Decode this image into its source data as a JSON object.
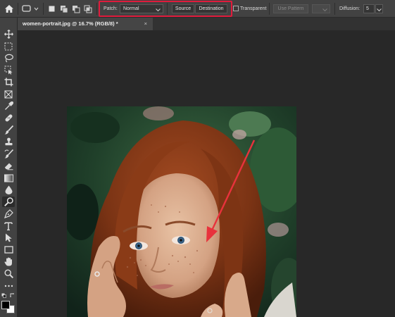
{
  "options_bar": {
    "home_icon": "home-icon",
    "tool_preset_icon": "patch-tool-preset-icon",
    "selection_modes": [
      "new-selection-icon",
      "add-to-selection-icon",
      "subtract-from-selection-icon",
      "intersect-selection-icon"
    ],
    "patch_label": "Patch:",
    "patch_value": "Normal",
    "source_label": "Source",
    "destination_label": "Destination",
    "transparent_label": "Transparent",
    "transparent_checked": false,
    "use_pattern_label": "Use Pattern",
    "diffusion_label": "Diffusion:",
    "diffusion_value": "5",
    "highlight_color": "#e01b3c"
  },
  "tab": {
    "title": "women-portrait.jpg @ 16.7% (RGB/8) *",
    "close": "×"
  },
  "toolbar": {
    "tools": [
      "move-tool-icon",
      "marquee-tool-icon",
      "lasso-tool-icon",
      "object-selection-tool-icon",
      "crop-tool-icon",
      "frame-tool-icon",
      "eyedropper-tool-icon",
      "healing-brush-tool-icon",
      "brush-tool-icon",
      "clone-stamp-tool-icon",
      "history-brush-tool-icon",
      "eraser-tool-icon",
      "gradient-tool-icon",
      "blur-tool-icon",
      "dodge-tool-icon",
      "pen-tool-icon",
      "type-tool-icon",
      "path-selection-tool-icon",
      "rectangle-tool-icon",
      "hand-tool-icon",
      "zoom-tool-icon",
      "more-tools-icon"
    ],
    "active_tool": "dodge-tool-icon",
    "foreground_color": "#000000",
    "background_color": "#ffffff"
  },
  "canvas": {
    "image": "portrait of red-haired freckled woman",
    "annotation_color": "#e8323c"
  }
}
